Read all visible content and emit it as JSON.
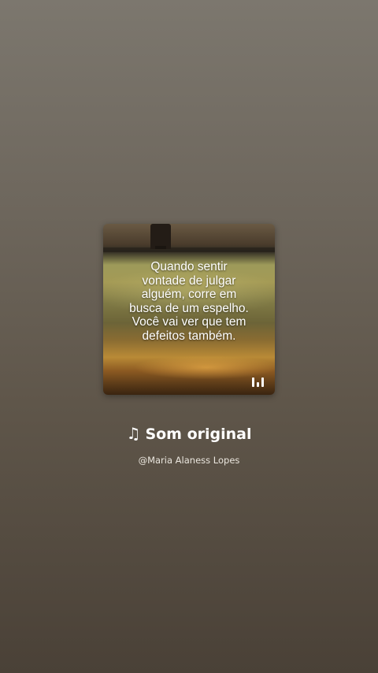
{
  "card": {
    "quote_lines": [
      "Quando sentir",
      "vontade de julgar",
      "alguém, corre em",
      "busca de um espelho.",
      "Você vai ver que tem",
      "defeitos também."
    ],
    "watermark_icon": "waveform-logo-icon"
  },
  "sound": {
    "icon": "music-note-icon",
    "title": "Som original",
    "author": "@Maria Alaness Lopes"
  },
  "colors": {
    "text": "#ffffff",
    "background_top": "#7c776e",
    "background_bottom": "#4a4137"
  }
}
